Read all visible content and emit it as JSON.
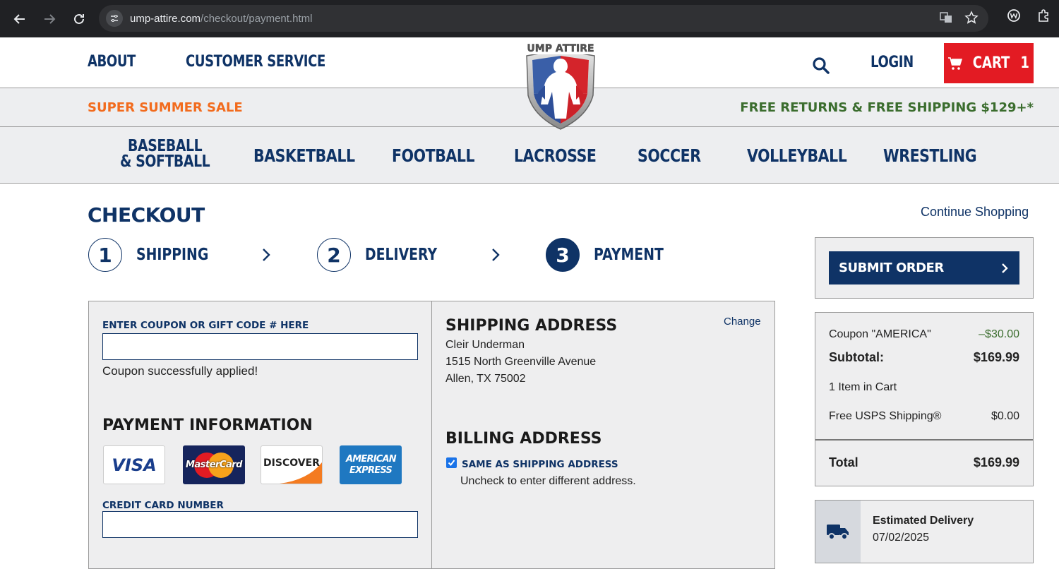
{
  "browser": {
    "url_domain": "ump-attire.com",
    "url_path": "/checkout/payment.html"
  },
  "header": {
    "nav": [
      "ABOUT",
      "CUSTOMER SERVICE"
    ],
    "login": "LOGIN",
    "cart_label": "CART",
    "cart_count": "1",
    "logo_text": "UMP ATTIRE"
  },
  "promo": {
    "sale": "SUPER SUMMER SALE",
    "free": "FREE RETURNS & FREE SHIPPING $129+*"
  },
  "categories": {
    "baseball_line1": "BASEBALL",
    "baseball_line2": "& SOFTBALL",
    "basketball": "BASKETBALL",
    "football": "FOOTBALL",
    "lacrosse": "LACROSSE",
    "soccer": "SOCCER",
    "volleyball": "VOLLEYBALL",
    "wrestling": "WRESTLING"
  },
  "checkout": {
    "title": "CHECKOUT",
    "continue": "Continue Shopping",
    "steps": [
      {
        "num": "1",
        "label": "SHIPPING"
      },
      {
        "num": "2",
        "label": "DELIVERY"
      },
      {
        "num": "3",
        "label": "PAYMENT"
      }
    ]
  },
  "coupon": {
    "label": "ENTER COUPON OR GIFT CODE # HERE",
    "value": "",
    "message": "Coupon successfully applied!"
  },
  "payment": {
    "title": "PAYMENT INFORMATION",
    "cards": [
      "VISA",
      "MasterCard",
      "DISCOVER",
      "AMERICAN EXPRESS"
    ],
    "cc_label": "CREDIT CARD NUMBER",
    "cc_value": ""
  },
  "shipping": {
    "title": "SHIPPING ADDRESS",
    "change": "Change",
    "name": "Cleir Underman",
    "street": "1515 North Greenville Avenue",
    "city": "Allen, TX 75002"
  },
  "billing": {
    "title": "BILLING ADDRESS",
    "same_label": "SAME AS SHIPPING ADDRESS",
    "same_checked": true,
    "hint": "Uncheck to enter different address."
  },
  "summary": {
    "submit": "SUBMIT ORDER",
    "coupon_label": "Coupon \"AMERICA\"",
    "coupon_value": "–$30.00",
    "subtotal_label": "Subtotal:",
    "subtotal_value": "$169.99",
    "items": "1 Item in Cart",
    "shipping_label": "Free USPS Shipping®",
    "shipping_value": "$0.00",
    "total_label": "Total",
    "total_value": "$169.99",
    "delivery_label": "Estimated Delivery",
    "delivery_date": "07/02/2025"
  },
  "colors": {
    "navy": "#0f3366",
    "red": "#e31b23",
    "orange": "#f26b1d",
    "green": "#3b6d2e"
  }
}
